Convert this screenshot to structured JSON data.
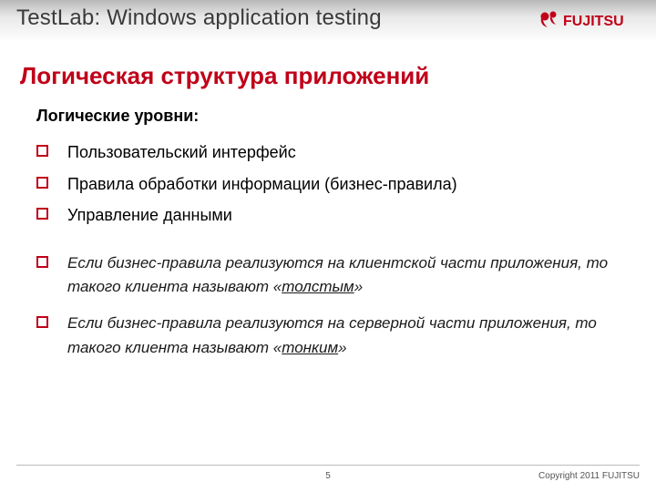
{
  "header": {
    "title": "TestLab: Windows application testing",
    "brand": "FUJITSU"
  },
  "section_title": "Логическая структура приложений",
  "intro_label": "Логические уровни:",
  "levels": [
    "Пользовательский интерфейс",
    "Правила обработки информации (бизнес-правила)",
    "Управление данными"
  ],
  "notes": [
    {
      "pre": "Если бизнес-правила реализуются на клиентской части приложения, то такого клиента называют «",
      "u": "толстым",
      "post": "»"
    },
    {
      "pre": "Если бизнес-правила реализуются на серверной части приложения, то такого клиента называют «",
      "u": "тонким",
      "post": "»"
    }
  ],
  "footer": {
    "page": "5",
    "copyright": "Copyright 2011 FUJITSU"
  }
}
